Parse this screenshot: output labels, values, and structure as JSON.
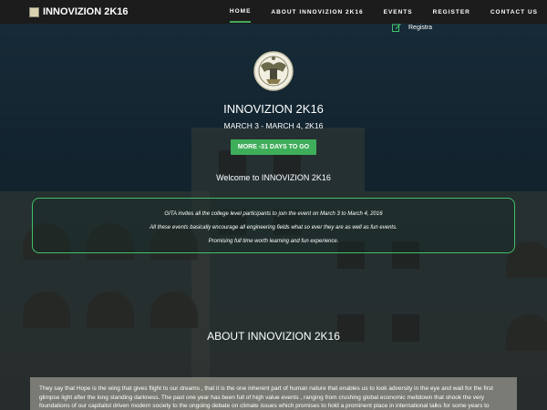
{
  "navbar": {
    "brand": "INNOVIZION 2K16",
    "items": [
      {
        "label": "HOME",
        "active": true
      },
      {
        "label": "ABOUT INNOVIZION 2K16",
        "active": false
      },
      {
        "label": "EVENTS",
        "active": false
      },
      {
        "label": "REGISTER",
        "active": false
      },
      {
        "label": "CONTACT US",
        "active": false
      }
    ],
    "registration_label": "Registra"
  },
  "hero": {
    "title": "INNOVIZION 2K16",
    "dates": "MARCH 3 - MARCH 4, 2K16",
    "cta_label": "MORE -31 DAYS TO GO"
  },
  "welcome": "Welcome to INNOVIZION 2K16",
  "info": {
    "lines": [
      "GITA invites all the college level participants to join the event on March 3 to March 4, 2016",
      "All these events basically encourage all engineering fields what so ever they are as well as fun events.",
      "Promising full time worth learning and fun experience."
    ]
  },
  "about": {
    "title": "ABOUT INNOVIZION 2K16",
    "text": "They say that Hope is the wing that gives flight to our dreams , that it is the one inherent part of human nature that enables us to look adversity in the eye and wait for the first glimpse light after the long standing darkness. The past one year has been full of high value events , ranging from crushing global economic meltdown that shook the very foundations of our capitalist driven modern society to the ongoing debate on climate issues which promises to hold a prominent place in international talks for some years to"
  },
  "colors": {
    "accent_green": "#43a85a",
    "navbar_bg": "#1c1c1c",
    "info_border": "#43c06a"
  },
  "icons": {
    "brand": "logo-icon",
    "registration": "edit-icon",
    "emblem": "emblem-icon"
  }
}
